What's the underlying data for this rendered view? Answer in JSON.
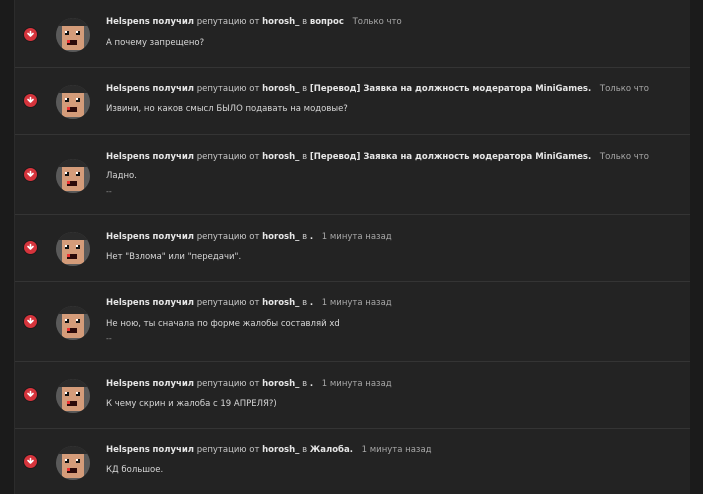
{
  "labels": {
    "verb": "получил",
    "rep": "репутацию от"
  },
  "icons": {
    "rep_down": "thumbs-down-icon",
    "avatar": "pixel-face-avatar"
  },
  "colors": {
    "accent_red": "#d5343c",
    "background": "#232323"
  },
  "items": [
    {
      "user": "Helspens",
      "from": "horosh_",
      "prep": "в",
      "topic": "вопрос",
      "time": "Только что",
      "text": "А почему запрещено?",
      "extra": ""
    },
    {
      "user": "Helspens",
      "from": "horosh_",
      "prep": "в",
      "topic": "[Перевод] Заявка на должность модератора MiniGames.",
      "time": "Только что",
      "text": "Извини, но каков смысл БЫЛО подавать на модовые?",
      "extra": ""
    },
    {
      "user": "Helspens",
      "from": "horosh_",
      "prep": "в",
      "topic": "[Перевод] Заявка на должность модератора MiniGames.",
      "time": "Только что",
      "text": "Ладно.",
      "extra": "--"
    },
    {
      "user": "Helspens",
      "from": "horosh_",
      "prep": "в",
      "topic": ".",
      "time": "1 минута назад",
      "text": "Нет \"Взлома\" или \"передачи\".",
      "extra": ""
    },
    {
      "user": "Helspens",
      "from": "horosh_",
      "prep": "в",
      "topic": ".",
      "time": "1 минута назад",
      "text": "Не ною, ты сначала по форме жалобы составляй xd",
      "extra": "--"
    },
    {
      "user": "Helspens",
      "from": "horosh_",
      "prep": "в",
      "topic": ".",
      "time": "1 минута назад",
      "text": "К чему скрин и жалоба с 19 АПРЕЛЯ?)",
      "extra": ""
    },
    {
      "user": "Helspens",
      "from": "horosh_",
      "prep": "в",
      "topic": "Жалоба.",
      "time": "1 минута назад",
      "text": "КД большое.",
      "extra": ""
    }
  ]
}
